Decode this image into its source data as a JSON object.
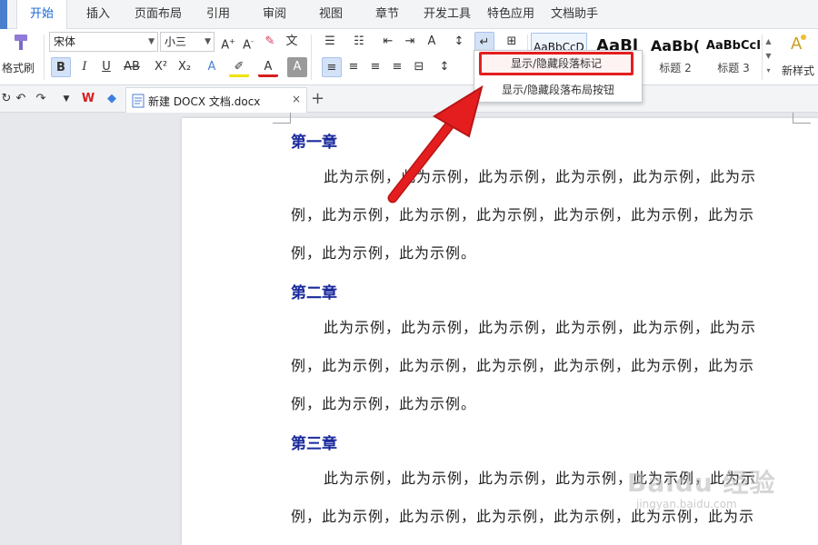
{
  "menu": {
    "tabs": [
      "开始",
      "插入",
      "页面布局",
      "引用",
      "审阅",
      "视图",
      "章节",
      "开发工具",
      "特色应用",
      "文档助手"
    ],
    "active_tab": "开始"
  },
  "ribbon": {
    "format_painter_label": "格式刷",
    "font_name": "宋体",
    "font_size": "小三",
    "style_samples": [
      "AaBbCcD",
      "AaBl",
      "AaBb(",
      "AaBbCcI"
    ],
    "style_names": [
      "",
      "",
      "标题 2",
      "标题 3"
    ],
    "new_style_label": "新样式"
  },
  "dropdown": {
    "items": [
      "显示/隐藏段落标记",
      "显示/隐藏段落布局按钮"
    ],
    "highlighted_index": 0,
    "highlight_color": "#e41e1e"
  },
  "document_tab": {
    "name": "新建 DOCX 文档.docx",
    "close": "×",
    "add": "+"
  },
  "document": {
    "chapters": [
      {
        "heading": "第一章",
        "lines": [
          "此为示例，此为示例，此为示例，此为示例，此为示例，此为示",
          "例，此为示例，此为示例，此为示例，此为示例，此为示例，此为示",
          "例，此为示例，此为示例。"
        ]
      },
      {
        "heading": "第二章",
        "lines": [
          "此为示例，此为示例，此为示例，此为示例，此为示例，此为示",
          "例，此为示例，此为示例，此为示例，此为示例，此为示例，此为示",
          "例，此为示例，此为示例。"
        ]
      },
      {
        "heading": "第三章",
        "lines": [
          "此为示例，此为示例，此为示例，此为示例，此为示例，此为示",
          "例，此为示例，此为示例，此为示例，此为示例，此为示例，此为示"
        ]
      }
    ]
  },
  "watermark": {
    "brand": "Baidu 经验",
    "sub": "jingyan.baidu.com"
  },
  "colors": {
    "accent": "#1a67d6",
    "heading": "#1a2a9c",
    "arrow": "#e41e1e"
  }
}
